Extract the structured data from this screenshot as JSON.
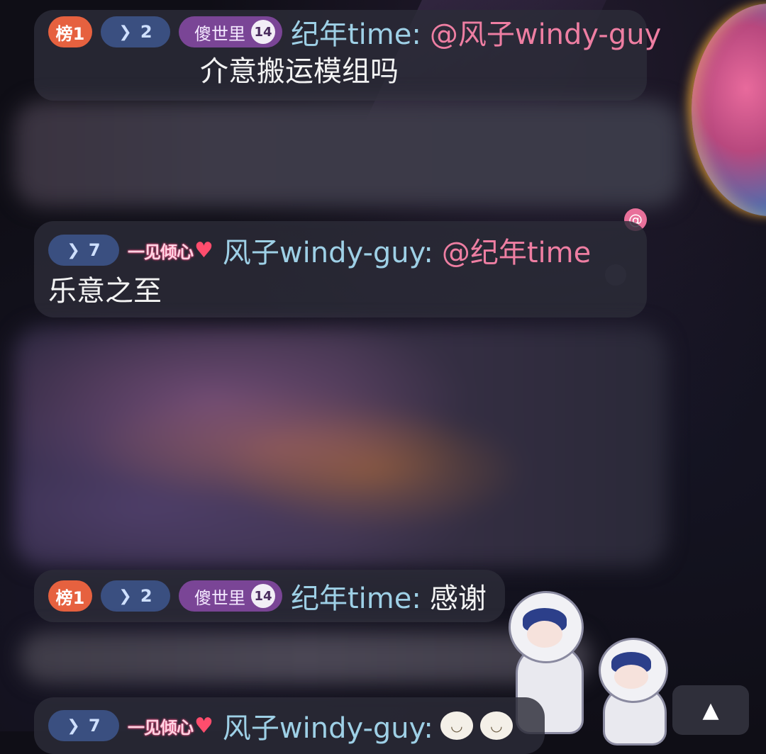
{
  "messages": [
    {
      "rank_badge": "榜1",
      "level": "2",
      "fan_badge": {
        "label": "傻世里",
        "level": "14"
      },
      "username": "纪年time:",
      "mention": "@风子windy-guy",
      "text": "介意搬运模组吗"
    },
    {
      "level": "7",
      "heart_badge": "一见倾心",
      "username": "风子windy-guy:",
      "mention": "@纪年time",
      "text": "乐意之至"
    },
    {
      "rank_badge": "榜1",
      "level": "2",
      "fan_badge": {
        "label": "傻世里",
        "level": "14"
      },
      "username": "纪年time:",
      "text": "感谢"
    },
    {
      "level": "7",
      "heart_badge": "一见倾心",
      "username": "风子windy-guy:"
    }
  ],
  "mention_indicator": "@",
  "scroll_up_icon": "▲",
  "icons": {
    "level": "chevron-down-icon",
    "heart": "heart-icon",
    "scroll": "triangle-up-icon"
  },
  "colors": {
    "rank": "#e6613f",
    "level": "#3a4f80",
    "fan": "#7a4596",
    "username": "#9ed0e6",
    "mention": "#ee7ea2",
    "message_text": "#f3f3f3"
  }
}
